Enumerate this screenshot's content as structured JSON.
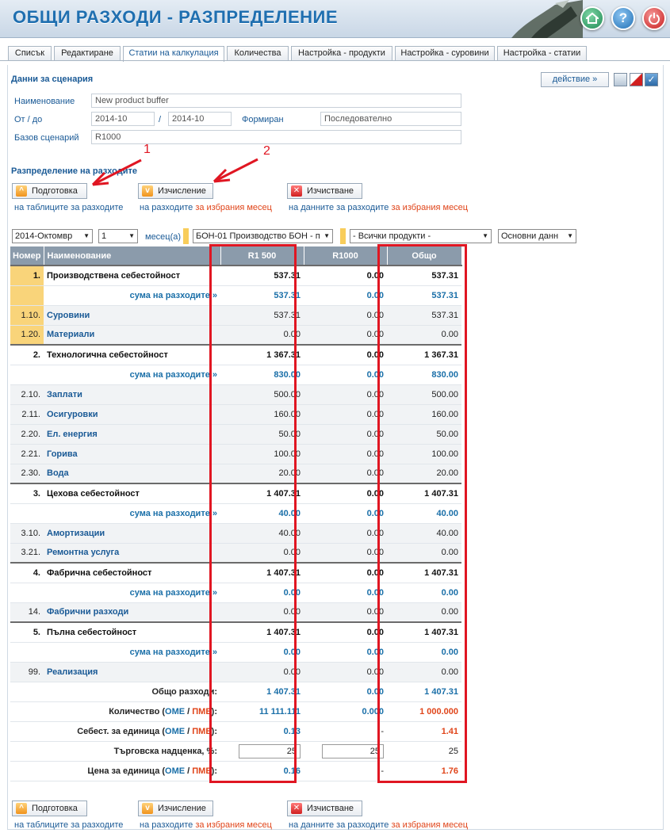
{
  "header": {
    "title": "ОБЩИ РАЗХОДИ - РАЗПРЕДЕЛЕНИЕ",
    "home_icon": "home-icon",
    "help_label": "?",
    "power_icon": "power-icon"
  },
  "tabs": [
    "Списък",
    "Редактиране",
    "Статии на калкулация",
    "Количества",
    "Настройка - продукти",
    "Настройка - суровини",
    "Настройка - статии"
  ],
  "scenario": {
    "title": "Данни за сценария",
    "action_label": "действие »",
    "name_label": "Наименование",
    "name_value": "New product buffer",
    "period_label": "От / до",
    "from_value": "2014-10",
    "sep": "/",
    "to_value": "2014-10",
    "formed_label": "Формиран",
    "formed_value": "Последователно",
    "base_label": "Базов сценарий",
    "base_value": "R1000"
  },
  "distribution": {
    "title": "Разпределение на разходите"
  },
  "actions": {
    "prepare_label": "Подготовка",
    "prepare_sub": "на таблиците за разходите",
    "calc_label": "Изчисление",
    "calc_sub_a": "на разходите ",
    "calc_sub_b": "за избрания месец",
    "clear_label": "Изчистване",
    "clear_sub_a": "на данните за разходите ",
    "clear_sub_b": "за избрания месец"
  },
  "filters": {
    "month": "2014-Октомвр",
    "count": "1",
    "count_unit": "месец(а)",
    "unit": "БОН-01 Производство БОН - п",
    "products": "- Всички продукти -",
    "view": "Основни данн"
  },
  "table": {
    "headers": [
      "Номер",
      "Наименование",
      "R1 500",
      "R1000",
      "Общо"
    ],
    "rows": [
      {
        "type": "main",
        "no": "1.",
        "name": "Производствена себестойност",
        "v": [
          "537.31",
          "0.00",
          "537.31"
        ]
      },
      {
        "type": "sum",
        "no": "",
        "name": "сума на разходите »",
        "v": [
          "537.31",
          "0.00",
          "537.31"
        ]
      },
      {
        "type": "item",
        "no": "1.10.",
        "name": "Суровини",
        "v": [
          "537.31",
          "0.00",
          "537.31"
        ]
      },
      {
        "type": "item",
        "no": "1.20.",
        "name": "Материали",
        "v": [
          "0.00",
          "0.00",
          "0.00"
        ]
      },
      {
        "type": "main",
        "no": "2.",
        "name": "Технологична себестойност",
        "v": [
          "1 367.31",
          "0.00",
          "1 367.31"
        ]
      },
      {
        "type": "sum",
        "no": "",
        "name": "сума на разходите »",
        "v": [
          "830.00",
          "0.00",
          "830.00"
        ]
      },
      {
        "type": "item",
        "no": "2.10.",
        "name": "Заплати",
        "v": [
          "500.00",
          "0.00",
          "500.00"
        ]
      },
      {
        "type": "item",
        "no": "2.11.",
        "name": "Осигуровки",
        "v": [
          "160.00",
          "0.00",
          "160.00"
        ]
      },
      {
        "type": "item",
        "no": "2.20.",
        "name": "Ел. енергия",
        "v": [
          "50.00",
          "0.00",
          "50.00"
        ]
      },
      {
        "type": "item",
        "no": "2.21.",
        "name": "Горива",
        "v": [
          "100.00",
          "0.00",
          "100.00"
        ]
      },
      {
        "type": "item",
        "no": "2.30.",
        "name": "Вода",
        "v": [
          "20.00",
          "0.00",
          "20.00"
        ]
      },
      {
        "type": "main",
        "no": "3.",
        "name": "Цехова себестойност",
        "v": [
          "1 407.31",
          "0.00",
          "1 407.31"
        ]
      },
      {
        "type": "sum",
        "no": "",
        "name": "сума на разходите »",
        "v": [
          "40.00",
          "0.00",
          "40.00"
        ]
      },
      {
        "type": "item",
        "no": "3.10.",
        "name": "Амортизации",
        "v": [
          "40.00",
          "0.00",
          "40.00"
        ]
      },
      {
        "type": "item",
        "no": "3.21.",
        "name": "Ремонтна услуга",
        "v": [
          "0.00",
          "0.00",
          "0.00"
        ]
      },
      {
        "type": "main",
        "no": "4.",
        "name": "Фабрична себестойност",
        "v": [
          "1 407.31",
          "0.00",
          "1 407.31"
        ]
      },
      {
        "type": "sum",
        "no": "",
        "name": "сума на разходите »",
        "v": [
          "0.00",
          "0.00",
          "0.00"
        ]
      },
      {
        "type": "item",
        "no": "14.",
        "name": "Фабрични разходи",
        "v": [
          "0.00",
          "0.00",
          "0.00"
        ]
      },
      {
        "type": "main",
        "no": "5.",
        "name": "Пълна себестойност",
        "v": [
          "1 407.31",
          "0.00",
          "1 407.31"
        ]
      },
      {
        "type": "sum",
        "no": "",
        "name": "сума на разходите »",
        "v": [
          "0.00",
          "0.00",
          "0.00"
        ]
      },
      {
        "type": "item",
        "no": "99.",
        "name": "Реализация",
        "v": [
          "0.00",
          "0.00",
          "0.00"
        ]
      }
    ],
    "footer": {
      "total_label": "Общо разходи:",
      "total_v": [
        "1 407.31",
        "0.00",
        "1 407.31"
      ],
      "qty_label": "Количество (",
      "ome": "ОМЕ",
      "slash": " / ",
      "pme": "ПМЕ",
      "close": "):",
      "qty_v": [
        "11 111.111",
        "0.000",
        "1 000.000"
      ],
      "unitcost_label": "Себест. за единица (",
      "unitcost_v": [
        "0.13",
        "-",
        "1.41"
      ],
      "markup_label": "Търговска надценка, %:",
      "markup_v": [
        "25",
        "25",
        "25"
      ],
      "price_label": "Цена за единица (",
      "price_v": [
        "0.16",
        "-",
        "1.76"
      ]
    }
  },
  "annotations": {
    "n1": "1",
    "n2": "2"
  }
}
